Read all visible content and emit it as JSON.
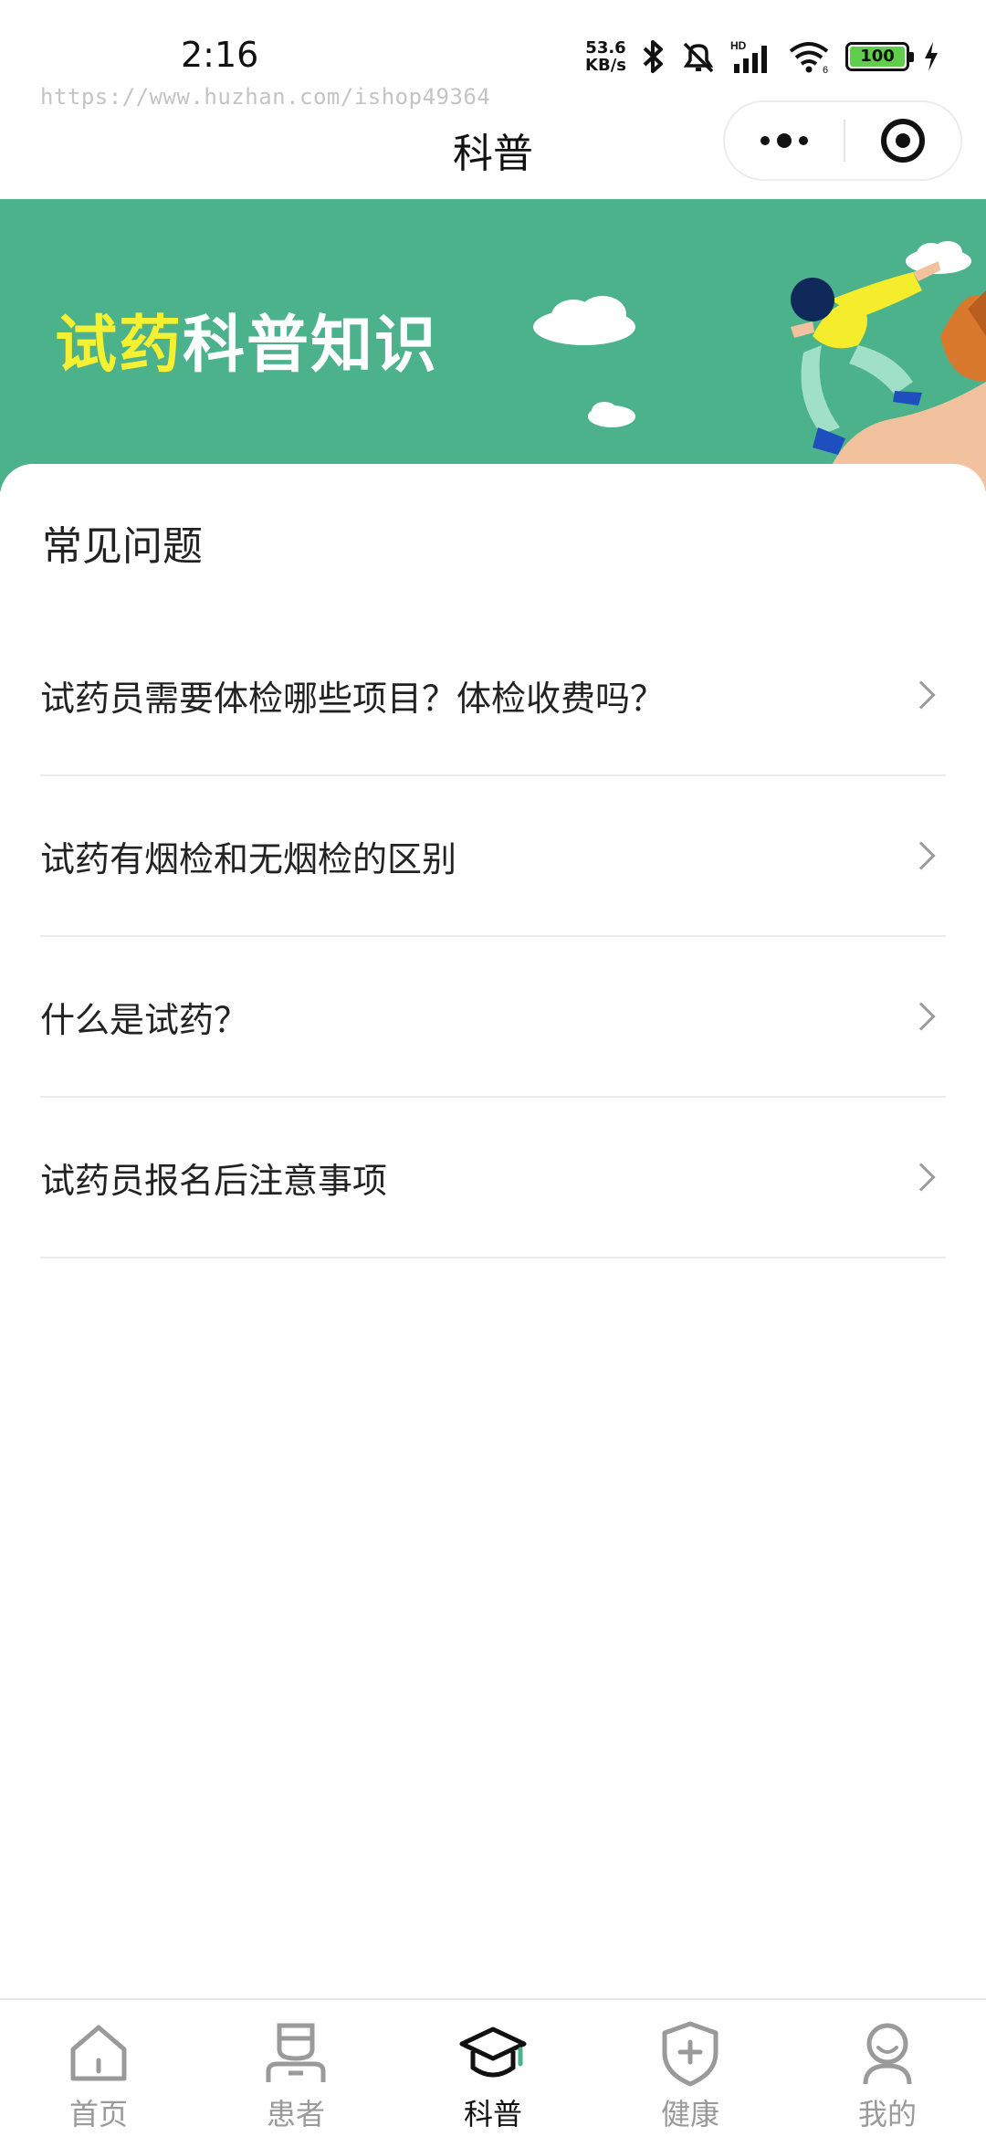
{
  "status_bar": {
    "time": "2:16",
    "net_speed_value": "53.6",
    "net_speed_unit": "KB/s",
    "battery": "100",
    "icons": [
      "bluetooth-icon",
      "mute-icon",
      "signal-icon",
      "wifi-icon",
      "battery-icon",
      "charging-icon"
    ]
  },
  "watermark": "https://www.huzhan.com/ishop49364",
  "nav": {
    "title": "科普"
  },
  "banner": {
    "title_highlight": "试药",
    "title_rest": "科普知识"
  },
  "faq": {
    "section_title": "常见问题",
    "items": [
      {
        "label": "试药员需要体检哪些项目？体检收费吗？"
      },
      {
        "label": "试药有烟检和无烟检的区别"
      },
      {
        "label": "什么是试药？"
      },
      {
        "label": "试药员报名后注意事项"
      }
    ]
  },
  "tabs": [
    {
      "label": "首页",
      "icon": "home-icon",
      "active": false
    },
    {
      "label": "患者",
      "icon": "patient-icon",
      "active": false
    },
    {
      "label": "科普",
      "icon": "graduation-cap-icon",
      "active": true
    },
    {
      "label": "健康",
      "icon": "shield-plus-icon",
      "active": false
    },
    {
      "label": "我的",
      "icon": "user-icon",
      "active": false
    }
  ],
  "colors": {
    "banner_bg": "#4cb28b",
    "banner_highlight": "#f5f032",
    "accent": "#4cb28b"
  }
}
